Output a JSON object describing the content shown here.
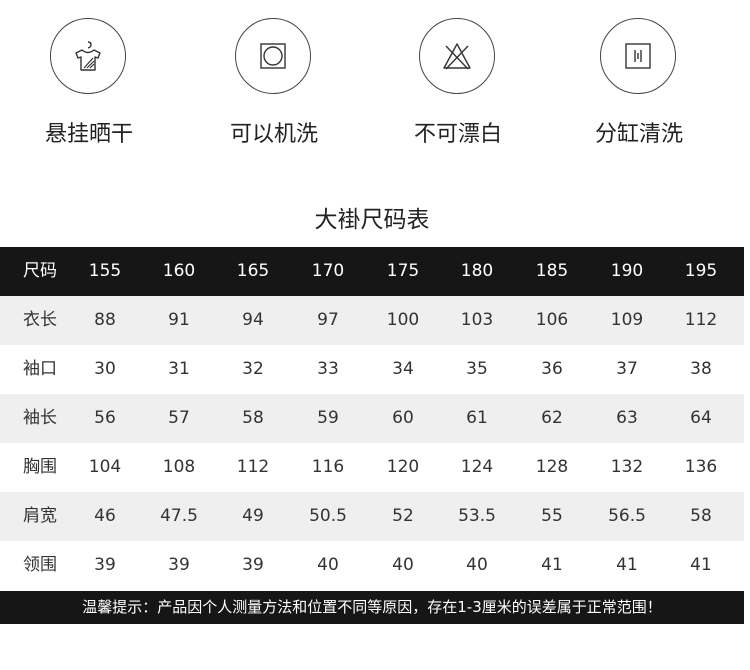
{
  "care": {
    "items": [
      {
        "label": "悬挂晒干",
        "icon": "hang-dry-icon"
      },
      {
        "label": "可以机洗",
        "icon": "machine-wash-icon"
      },
      {
        "label": "不可漂白",
        "icon": "no-bleach-icon"
      },
      {
        "label": "分缸清洗",
        "icon": "wash-separately-icon"
      }
    ]
  },
  "table": {
    "title": "大褂尺码表",
    "header": {
      "label": "尺码",
      "values": [
        "155",
        "160",
        "165",
        "170",
        "175",
        "180",
        "185",
        "190",
        "195"
      ]
    },
    "rows": [
      {
        "label": "衣长",
        "values": [
          "88",
          "91",
          "94",
          "97",
          "100",
          "103",
          "106",
          "109",
          "112"
        ]
      },
      {
        "label": "袖口",
        "values": [
          "30",
          "31",
          "32",
          "33",
          "34",
          "35",
          "36",
          "37",
          "38"
        ]
      },
      {
        "label": "袖长",
        "values": [
          "56",
          "57",
          "58",
          "59",
          "60",
          "61",
          "62",
          "63",
          "64"
        ]
      },
      {
        "label": "胸围",
        "values": [
          "104",
          "108",
          "112",
          "116",
          "120",
          "124",
          "128",
          "132",
          "136"
        ]
      },
      {
        "label": "肩宽",
        "values": [
          "46",
          "47.5",
          "49",
          "50.5",
          "52",
          "53.5",
          "55",
          "56.5",
          "58"
        ]
      },
      {
        "label": "领围",
        "values": [
          "39",
          "39",
          "39",
          "40",
          "40",
          "40",
          "41",
          "41",
          "41"
        ]
      }
    ]
  },
  "note": {
    "text": "温馨提示：产品因个人测量方法和位置不同等原因，存在1-3厘米的误差属于正常范围！"
  },
  "colors": {
    "header_bg": "#161616",
    "shaded_row": "#efefef",
    "text": "#222222"
  }
}
